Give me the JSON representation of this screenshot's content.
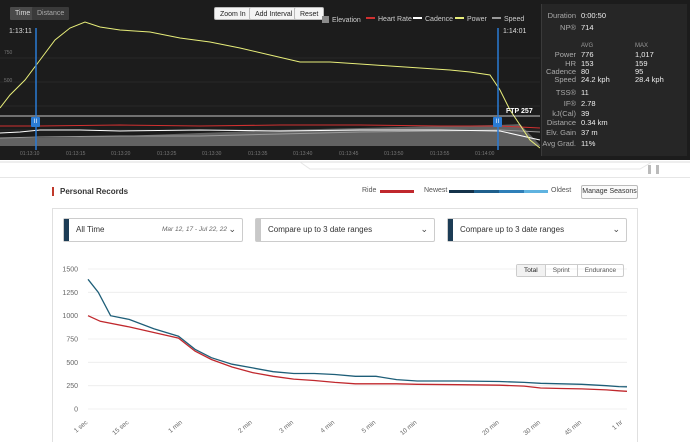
{
  "top_chart": {
    "tabs": [
      "Time",
      "Distance"
    ],
    "active_tab": "Time",
    "buttons": {
      "zoom": "Zoom In",
      "add": "Add Interval",
      "reset": "Reset"
    },
    "legend": [
      {
        "label": "Elevation",
        "color": "#8a8a8a",
        "kind": "box"
      },
      {
        "label": "Heart Rate",
        "color": "#d03030",
        "kind": "line"
      },
      {
        "label": "Cadence",
        "color": "#ffffff",
        "kind": "line"
      },
      {
        "label": "Power",
        "color": "#e8ee7a",
        "kind": "line"
      },
      {
        "label": "Speed",
        "color": "#999999",
        "kind": "line"
      }
    ],
    "selection_start": "1:13:11",
    "selection_end": "1:14:01",
    "ftp_label": "FTP 257",
    "ytick_labels": [
      "750",
      "500"
    ],
    "time_ticks": [
      "01:13:10",
      "01:13:15",
      "01:13:20",
      "01:13:25",
      "01:13:30",
      "01:13:35",
      "01:13:40",
      "01:13:45",
      "01:13:50",
      "01:13:55",
      "01:14:00"
    ]
  },
  "stats": {
    "duration_label": "Duration",
    "duration": "0:00:50",
    "np_label": "NP®",
    "np": "714",
    "avg_head": "AVG",
    "max_head": "MAX",
    "rows": [
      {
        "label": "Power",
        "avg": "776",
        "max": "1,017"
      },
      {
        "label": "HR",
        "avg": "153",
        "max": "159"
      },
      {
        "label": "Cadence",
        "avg": "80",
        "max": "95"
      },
      {
        "label": "Speed",
        "avg": "24.2 kph",
        "max": "28.4 kph"
      }
    ],
    "tss_label": "TSS®",
    "tss": "11",
    "if_label": "IF®",
    "if": "2.78",
    "kj_label": "kJ(Cal)",
    "kj": "39",
    "dist_label": "Distance",
    "dist": "0.34 km",
    "gain_label": "Elv. Gain",
    "gain": "37 m",
    "grade_label": "Avg Grad.",
    "grade": "11%"
  },
  "pr": {
    "title": "Personal Records",
    "ride_label": "Ride",
    "newest_label": "Newest",
    "oldest_label": "Oldest",
    "manage_label": "Manage Seasons",
    "range1": {
      "label": "All Time",
      "dates": "Mar 12, 17 - Jul 22, 22"
    },
    "range2": {
      "label": "Compare up to 3 date ranges"
    },
    "range3": {
      "label": "Compare up to 3 date ranges"
    },
    "segments": [
      "Total",
      "Sprint",
      "Endurance"
    ],
    "active_segment": "Total",
    "colors": {
      "ride": "#c0282d",
      "blue": "#1e5e78",
      "newest_bar": [
        "#14324a",
        "#1f5f8c",
        "#2f7fb8",
        "#5fb3e0"
      ]
    }
  },
  "chart_data": {
    "type": "line",
    "title": "",
    "xlabel": "",
    "ylabel": "",
    "ylim": [
      0,
      1500
    ],
    "yticks": [
      "1500",
      "1250",
      "1000",
      "750",
      "500",
      "250",
      "0"
    ],
    "x_categories": [
      "1 sec",
      "15 sec",
      "1 min",
      "2 min",
      "3 min",
      "4 min",
      "5 min",
      "10 min",
      "20 min",
      "30 min",
      "45 min",
      "1 hr"
    ],
    "x_positions": [
      0,
      1,
      2.3,
      4,
      5,
      6,
      7,
      8,
      10,
      11,
      12,
      13
    ],
    "series": [
      {
        "name": "Newest",
        "color": "#1e5e78",
        "points": [
          [
            0,
            1390
          ],
          [
            0.25,
            1250
          ],
          [
            0.55,
            1000
          ],
          [
            1,
            960
          ],
          [
            1.6,
            860
          ],
          [
            2.2,
            780
          ],
          [
            2.6,
            640
          ],
          [
            3,
            550
          ],
          [
            3.5,
            480
          ],
          [
            4,
            440
          ],
          [
            4.5,
            400
          ],
          [
            5,
            380
          ],
          [
            5.5,
            380
          ],
          [
            6,
            370
          ],
          [
            6.5,
            350
          ],
          [
            7,
            350
          ],
          [
            7.5,
            315
          ],
          [
            8,
            300
          ],
          [
            9,
            300
          ],
          [
            10,
            295
          ],
          [
            10.6,
            285
          ],
          [
            11,
            275
          ],
          [
            11.5,
            270
          ],
          [
            12,
            265
          ],
          [
            12.6,
            250
          ],
          [
            12.9,
            240
          ],
          [
            13.1,
            238
          ]
        ]
      },
      {
        "name": "Ride",
        "color": "#c0282d",
        "points": [
          [
            0,
            1000
          ],
          [
            0.3,
            940
          ],
          [
            1,
            880
          ],
          [
            1.6,
            820
          ],
          [
            2.2,
            760
          ],
          [
            2.6,
            620
          ],
          [
            3,
            530
          ],
          [
            3.5,
            450
          ],
          [
            4,
            390
          ],
          [
            4.5,
            350
          ],
          [
            5,
            320
          ],
          [
            5.5,
            305
          ],
          [
            6,
            285
          ],
          [
            6.5,
            270
          ],
          [
            7,
            270
          ],
          [
            7.5,
            270
          ],
          [
            8,
            265
          ],
          [
            9,
            260
          ],
          [
            10,
            255
          ],
          [
            10.6,
            245
          ],
          [
            11,
            225
          ],
          [
            11.5,
            220
          ],
          [
            12,
            215
          ],
          [
            12.6,
            205
          ],
          [
            12.9,
            195
          ],
          [
            13.1,
            190
          ]
        ]
      }
    ],
    "grid": true
  }
}
